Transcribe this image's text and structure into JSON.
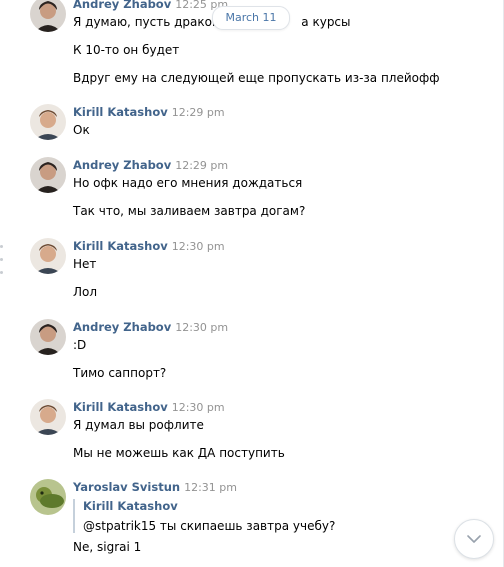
{
  "date_divider": "March 11",
  "messages": [
    {
      "author": "Andrey Zhabov",
      "time": "12:25 pm",
      "lines": [
        "Я думаю, пусть дракон л",
        "а курсы",
        "К 10-то он будет",
        "Вдруг ему на следующей еще пропускать из-за плейофф"
      ]
    },
    {
      "author": "Kirill Katashov",
      "time": "12:29 pm",
      "lines": [
        "Ок"
      ]
    },
    {
      "author": "Andrey Zhabov",
      "time": "12:29 pm",
      "lines": [
        "Но офк надо его мнения дождаться",
        "Так что, мы заливаем завтра догам?"
      ]
    },
    {
      "author": "Kirill Katashov",
      "time": "12:30 pm",
      "lines": [
        "Нет",
        "Лол"
      ]
    },
    {
      "author": "Andrey Zhabov",
      "time": "12:30 pm",
      "lines": [
        ":D",
        "Тимо саппорт?"
      ]
    },
    {
      "author": "Kirill Katashov",
      "time": "12:30 pm",
      "lines": [
        "Я думал вы рофлите",
        "Мы не можешь как ДА поступить"
      ]
    },
    {
      "author": "Yaroslav Svistun",
      "time": "12:31 pm",
      "quote": {
        "author": "Kirill Katashov",
        "text": "@stpatrik15 ты скипаешь завтра учебу?"
      },
      "lines": [
        "Ne, sigrai 1"
      ]
    }
  ],
  "icons": {
    "scroll_down": "chevron-down-icon"
  },
  "colors": {
    "author": "#42648b",
    "time": "#939393",
    "accent": "#4a76a8"
  }
}
